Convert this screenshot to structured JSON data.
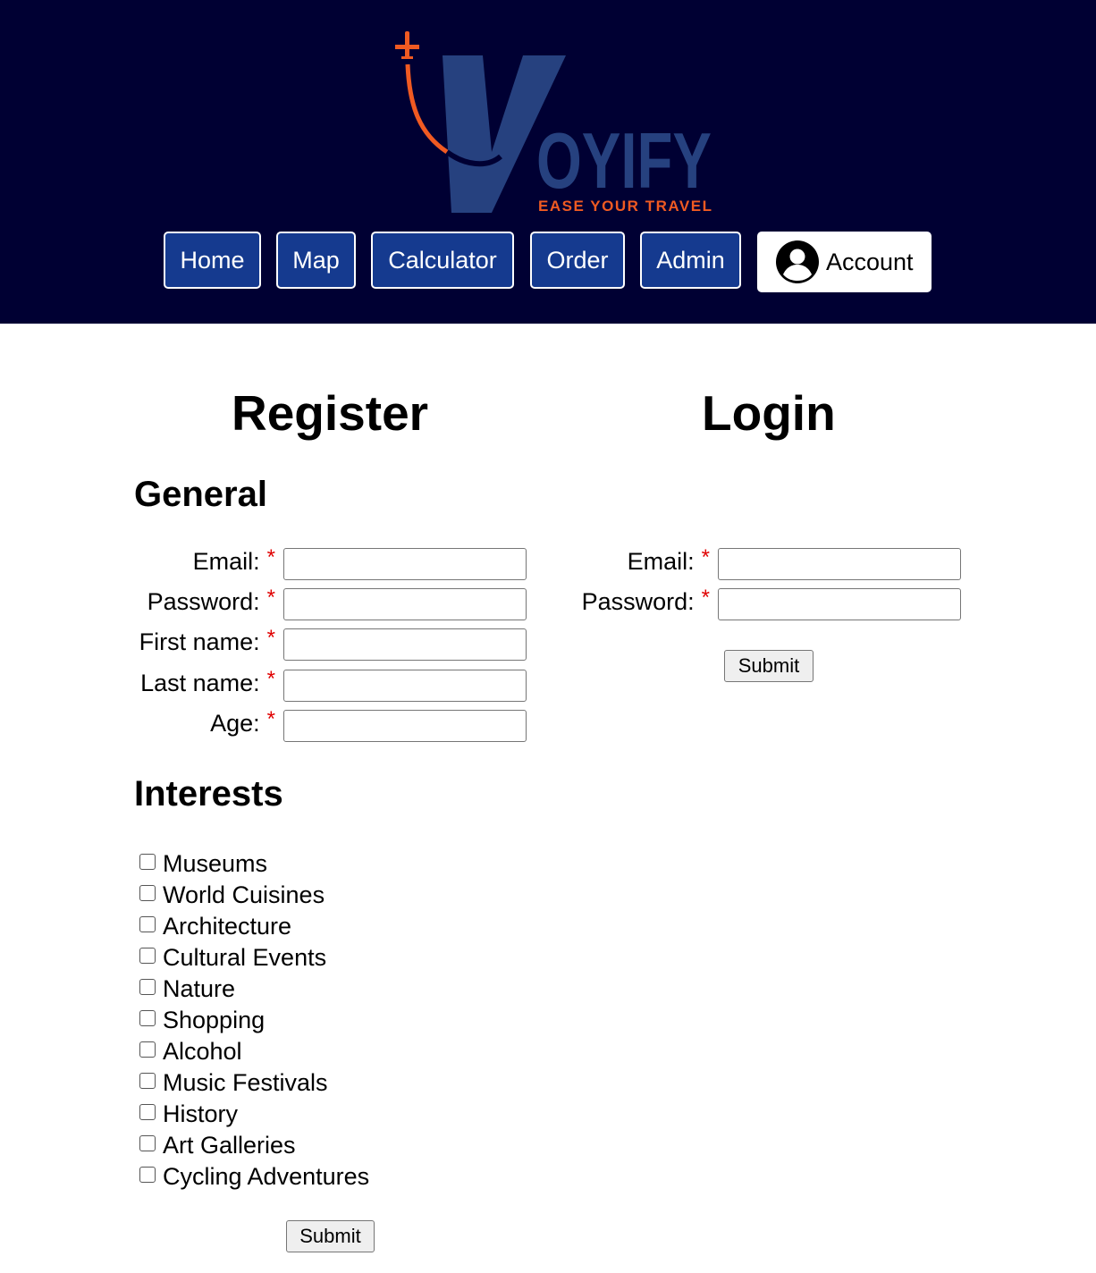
{
  "header": {
    "logo": {
      "wordmark": "VOYIFY",
      "tagline": "EASE YOUR TRAVEL",
      "colors": {
        "primary": "#26417f",
        "accent": "#f05a22"
      }
    },
    "nav": [
      {
        "label": "Home"
      },
      {
        "label": "Map"
      },
      {
        "label": "Calculator"
      },
      {
        "label": "Order"
      },
      {
        "label": "Admin"
      }
    ],
    "account_label": "Account",
    "background": "#000033",
    "button_color": "#153a8f"
  },
  "register": {
    "title": "Register",
    "general_heading": "General",
    "fields": [
      {
        "label": "Email:",
        "required_mark": "*",
        "value": ""
      },
      {
        "label": "Password:",
        "required_mark": "*",
        "value": ""
      },
      {
        "label": "First name:",
        "required_mark": "*",
        "value": ""
      },
      {
        "label": "Last name:",
        "required_mark": "*",
        "value": ""
      },
      {
        "label": "Age:",
        "required_mark": "*",
        "value": ""
      }
    ],
    "interests_heading": "Interests",
    "interests": [
      {
        "label": "Museums",
        "checked": false
      },
      {
        "label": "World Cuisines",
        "checked": false
      },
      {
        "label": "Architecture",
        "checked": false
      },
      {
        "label": "Cultural Events",
        "checked": false
      },
      {
        "label": "Nature",
        "checked": false
      },
      {
        "label": "Shopping",
        "checked": false
      },
      {
        "label": "Alcohol",
        "checked": false
      },
      {
        "label": "Music Festivals",
        "checked": false
      },
      {
        "label": "History",
        "checked": false
      },
      {
        "label": "Art Galleries",
        "checked": false
      },
      {
        "label": "Cycling Adventures",
        "checked": false
      }
    ],
    "submit_label": "Submit"
  },
  "login": {
    "title": "Login",
    "fields": [
      {
        "label": "Email:",
        "required_mark": "*",
        "value": ""
      },
      {
        "label": "Password:",
        "required_mark": "*",
        "value": ""
      }
    ],
    "submit_label": "Submit"
  }
}
